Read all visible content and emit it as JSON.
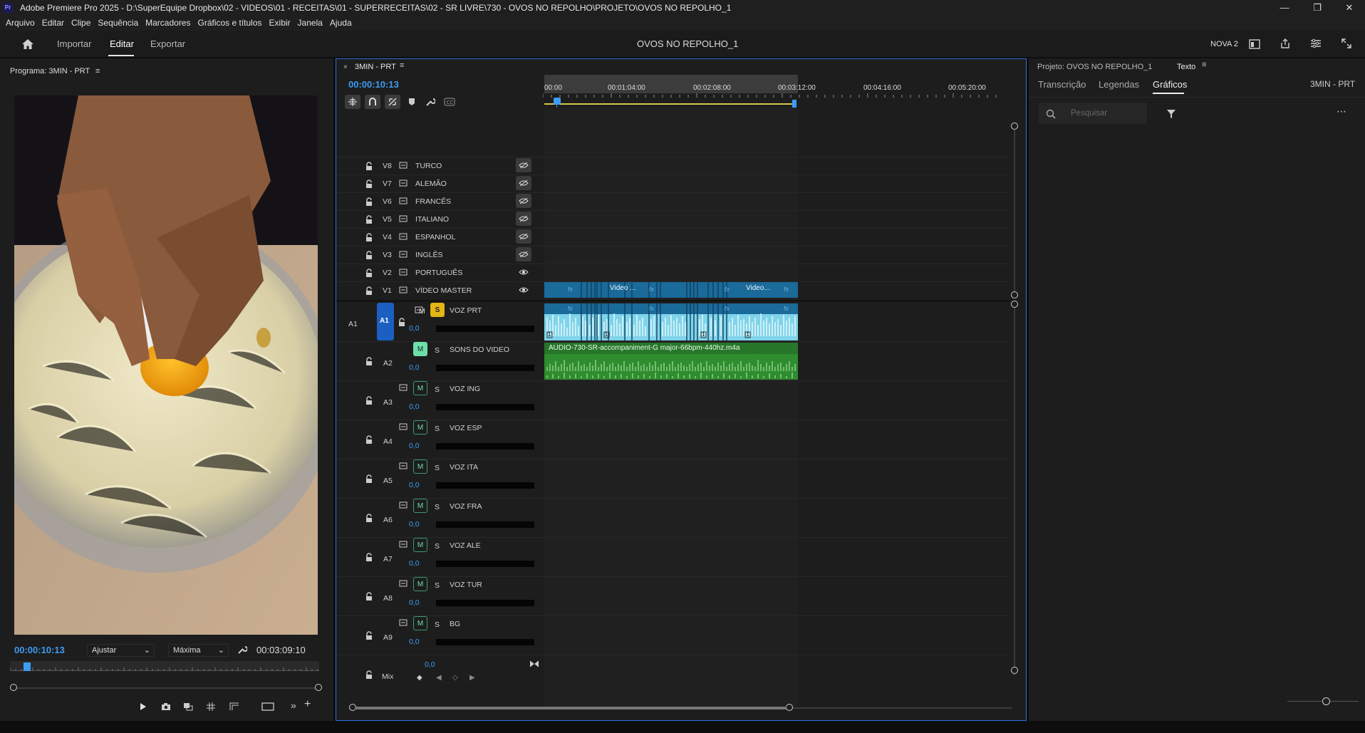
{
  "app": {
    "title": "Adobe Premiere Pro 2025 - D:\\SuperEquipe Dropbox\\02 - VIDEOS\\01 - RECEITAS\\01 - SUPERRECEITAS\\02 - SR LIVRE\\730 - OVOS NO REPOLHO\\PROJETO\\OVOS NO REPOLHO_1",
    "logo": "Pr"
  },
  "menu": [
    "Arquivo",
    "Editar",
    "Clipe",
    "Sequência",
    "Marcadores",
    "Gráficos e títulos",
    "Exibir",
    "Janela",
    "Ajuda"
  ],
  "workspace": {
    "tabs": [
      "Importar",
      "Editar",
      "Exportar"
    ],
    "active": "Editar",
    "project_title": "OVOS NO REPOLHO_1",
    "workspace_name": "NOVA 2"
  },
  "program": {
    "header": "Programa: 3MIN - PRT",
    "timecode": "00:00:10:13",
    "fit": "Ajustar",
    "quality": "Máxima",
    "duration": "00:03:09:10"
  },
  "timeline": {
    "tab": "3MIN - PRT",
    "timecode": "00:00:10:13",
    "ruler": [
      "00:00",
      "00:01:04:00",
      "00:02:08:00",
      "00:03:12:00",
      "00:04:16:00",
      "00:05:20:00"
    ],
    "video_tracks": [
      {
        "id": "V8",
        "name": "TURCO"
      },
      {
        "id": "V7",
        "name": "ALEMÃO"
      },
      {
        "id": "V6",
        "name": "FRANCÊS"
      },
      {
        "id": "V5",
        "name": "ITALIANO"
      },
      {
        "id": "V4",
        "name": "ESPANHOL"
      },
      {
        "id": "V3",
        "name": "INGLÊS"
      },
      {
        "id": "V2",
        "name": "PORTUGUÊS"
      },
      {
        "id": "V1",
        "name": "VÍDEO MASTER"
      }
    ],
    "audio_tracks": [
      {
        "id": "A2",
        "name": "SONS DO VIDEO",
        "level": "0,0"
      },
      {
        "id": "A3",
        "name": "VOZ ING",
        "level": "0,0"
      },
      {
        "id": "A4",
        "name": "VOZ ESP",
        "level": "0,0"
      },
      {
        "id": "A5",
        "name": "VOZ ITA",
        "level": "0,0"
      },
      {
        "id": "A6",
        "name": "VOZ FRA",
        "level": "0,0"
      },
      {
        "id": "A7",
        "name": "VOZ ALE",
        "level": "0,0"
      },
      {
        "id": "A8",
        "name": "VOZ TUR",
        "level": "0,0"
      },
      {
        "id": "A9",
        "name": "BG",
        "level": "0,0"
      }
    ],
    "a1": {
      "src": "A1",
      "id": "A1",
      "name": "VOZ PRT",
      "level": "0,0",
      "m": "M",
      "s": "S"
    },
    "m_label": "M",
    "s_label": "S",
    "mix": {
      "label": "Mix",
      "level": "0,0"
    },
    "clip_v1_a": "Video ...",
    "clip_v1_b": "Video...",
    "clip_a2": "AUDIO-730-SR-accompaniment-G major-66bpm-440hz.m4a",
    "fx": "fx",
    "clip_marker": "1"
  },
  "right": {
    "project_tab": "Projeto: OVOS NO REPOLHO_1",
    "text_tab": "Texto",
    "subtabs": [
      "Transcrição",
      "Legendas",
      "Gráficos"
    ],
    "active_subtab": "Gráficos",
    "sequence": "3MIN - PRT",
    "search_placeholder": "Pesquisar"
  }
}
